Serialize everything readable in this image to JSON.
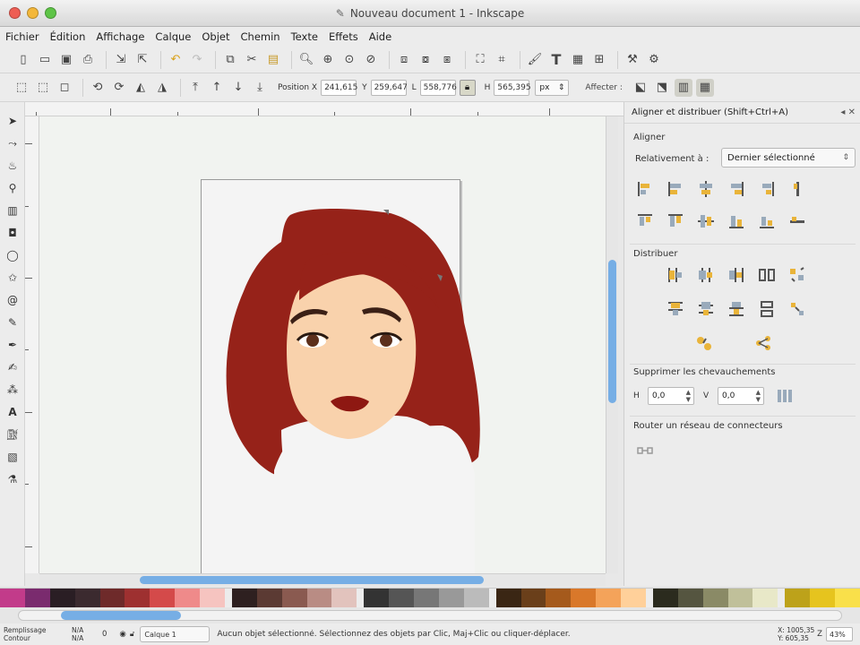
{
  "window": {
    "title": "Nouveau document 1 - Inkscape",
    "app_icon": "inkscape-icon"
  },
  "menu": [
    "Fichier",
    "Édition",
    "Affichage",
    "Calque",
    "Objet",
    "Chemin",
    "Texte",
    "Effets",
    "Aide"
  ],
  "toolbar_commands": {
    "icons": [
      "new-document-icon",
      "open-icon",
      "save-icon",
      "print-icon",
      "import-icon",
      "export-icon",
      "undo-icon",
      "redo-icon",
      "copy-icon",
      "cut-icon",
      "paste-icon",
      "zoom-selection-icon",
      "zoom-drawing-icon",
      "zoom-page-icon",
      "duplicate-icon",
      "clone-icon",
      "unlink-clone-icon",
      "group-icon",
      "ungroup-icon",
      "fill-stroke-icon",
      "text-font-icon",
      "xml-editor-icon",
      "align-icon",
      "preferences-icon",
      "document-properties-icon"
    ]
  },
  "toolbar_select": {
    "x_label": "Position X",
    "x_value": "241,615",
    "y_label": "Y",
    "y_value": "259,647",
    "w_label": "L",
    "w_value": "558,776",
    "h_label": "H",
    "h_value": "565,395",
    "unit": "px",
    "affect_label": "Affecter :"
  },
  "dock": {
    "title": "Aligner et distribuer (Shift+Ctrl+A)",
    "align_section": "Aligner",
    "relative_label": "Relativement à :",
    "relative_value": "Dernier sélectionné",
    "distribute_section": "Distribuer",
    "overlap_section": "Supprimer les chevauchements",
    "h_label": "H",
    "h_value": "0,0",
    "v_label": "V",
    "v_value": "0,0",
    "connector_section": "Router un réseau de connecteurs"
  },
  "palette": [
    "#c23b8a",
    "#7a2b6e",
    "#2a1e24",
    "#3b2a2f",
    "#6e2a2a",
    "#9e3030",
    "#d44a4a",
    "#ef8a8a",
    "#f6c4c0",
    "#2e2020",
    "#5b3a33",
    "#8a5a50",
    "#b98c84",
    "#e2c3bd",
    "#333333",
    "#555555",
    "#777777",
    "#999999",
    "#bbbbbb",
    "#3a2614",
    "#6a3f1a",
    "#a55a1c",
    "#d9782a",
    "#f4a35a",
    "#ffd09a",
    "#2b2b1e",
    "#555540",
    "#8a8a66",
    "#c0c09a",
    "#e8e8c8",
    "#bda21a",
    "#e6c41e",
    "#f9e04a"
  ],
  "status": {
    "fill_label": "Remplissage",
    "stroke_label": "Contour",
    "fill_value": "N/A",
    "stroke_value": "N/A",
    "opacity_value": "0",
    "layer": "Calque 1",
    "message": "Aucun objet sélectionné. Sélectionnez des objets par Clic, Maj+Clic ou cliquer-déplacer.",
    "coord_x": "X: 1005,35",
    "coord_y": "Y: 605,35",
    "zoom_label": "Z",
    "zoom_value": "43%"
  }
}
